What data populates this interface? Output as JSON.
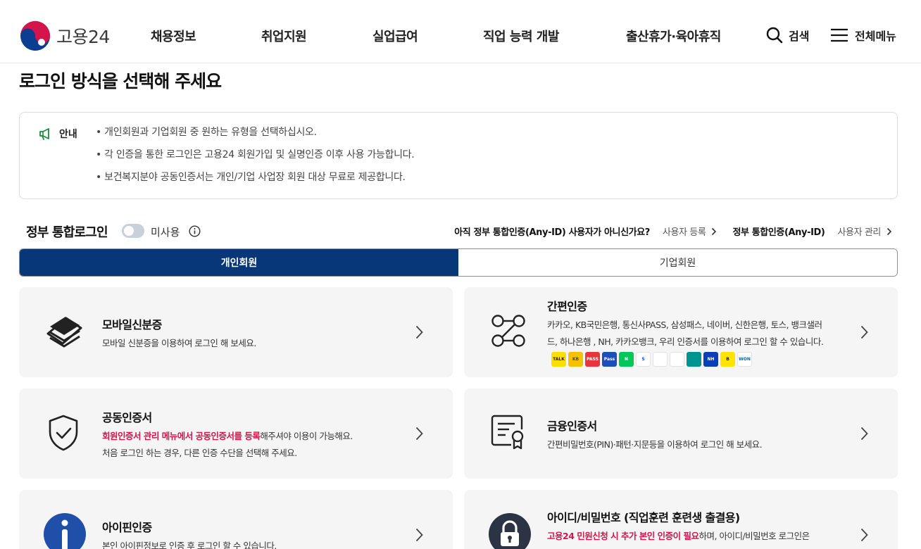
{
  "header": {
    "logo_text": "고용24",
    "nav": [
      "채용정보",
      "취업지원",
      "실업급여",
      "직업 능력 개발",
      "출산휴가·육아휴직"
    ],
    "search_label": "검색",
    "menu_label": "전체메뉴"
  },
  "page_title": "로그인 방식을 선택해 주세요",
  "notice": {
    "label": "안내",
    "items": [
      "개인회원과 기업회원 중 원하는 유형을 선택하십시오.",
      "각 인증을 통한 로그인은 고용24 회원가입 및 실명인증 이후 사용 가능합니다.",
      "보건복지분야 공동인증서는 개인/기업 사업장 회원 대상 무료로 제공합니다."
    ]
  },
  "gov_login": {
    "title": "정부 통합로그인",
    "status": "미사용",
    "question": "아직 정부 통합인증(Any-ID) 사용자가 아니신가요?",
    "register": "사용자 등록",
    "anyid": "정부 통합인증(Any-ID)",
    "manage": "사용자 관리"
  },
  "tabs": {
    "personal": "개인회원",
    "corporate": "기업회원"
  },
  "cards": {
    "mobile": {
      "title": "모바일신분증",
      "desc": "모바일 신분증을 이용하여 로그인 해 보세요."
    },
    "simple": {
      "title": "간편인증",
      "desc1": "카카오, KB국민은행, 통신사PASS, 삼성패스, 네이버, 신한은행, 토스, 뱅크샐러",
      "desc2": "드, 하나은행 , NH, 카카오뱅크, 우리 인증서를 이용하여 로그인 할 수 있습니다."
    },
    "joint": {
      "title": "공동인증서",
      "desc1_red": "회원인증서 관리 메뉴에서 공동인증서를 등록",
      "desc1_rest": "해주셔야 이용이 가능해요.",
      "desc2": "처음 로그인 하는 경우, 다른 인증 수단을 선택해 주세요."
    },
    "finance": {
      "title": "금융인증서",
      "desc": "간편비밀번호(PIN)·패턴·지문등을 이용하여 로그인 해 보세요."
    },
    "ipin": {
      "title": "아이핀인증",
      "desc": "본인 아이핀정보로 인증 후 로그인 할 수 있습니다."
    },
    "idpw": {
      "title": "아이디/비밀번호 (직업훈련 훈련생 출결용)",
      "desc_red": "고용24 민원신청 시 추가 본인 인증이 필요",
      "desc_rest": "하며, 아이디/비밀번호 로그인은"
    }
  },
  "banks": [
    {
      "name": "kakao",
      "label": "TALK",
      "color": "#f9e000",
      "text": "#3a1d1d"
    },
    {
      "name": "kb",
      "label": "KB",
      "color": "#f6c200",
      "text": "#5a4a20"
    },
    {
      "name": "pass",
      "label": "PASS",
      "color": "#e8343c",
      "text": "#ffffff"
    },
    {
      "name": "samsung",
      "label": "Pass",
      "color": "#1d4fb8",
      "text": "#ffffff"
    },
    {
      "name": "naver",
      "label": "N",
      "color": "#03c75a",
      "text": "#ffffff"
    },
    {
      "name": "shinhan",
      "label": "S",
      "color": "#ffffff",
      "text": "#0046ff"
    },
    {
      "name": "toss",
      "label": "",
      "color": "#ffffff",
      "text": "#0064ff"
    },
    {
      "name": "banksalad",
      "label": "",
      "color": "#ffffff",
      "text": "#00c28c"
    },
    {
      "name": "hana",
      "label": "",
      "color": "#009490",
      "text": "#ffffff"
    },
    {
      "name": "nh",
      "label": "NH",
      "color": "#0a3fb8",
      "text": "#ffffff"
    },
    {
      "name": "kakaobank",
      "label": "B",
      "color": "#ffe400",
      "text": "#1e1e1e"
    },
    {
      "name": "woori",
      "label": "WON",
      "color": "#ffffff",
      "text": "#0067ac"
    }
  ],
  "colors": {
    "primary": "#083778",
    "accent_red": "#d6144c",
    "card_bg": "#f5f5f5"
  }
}
